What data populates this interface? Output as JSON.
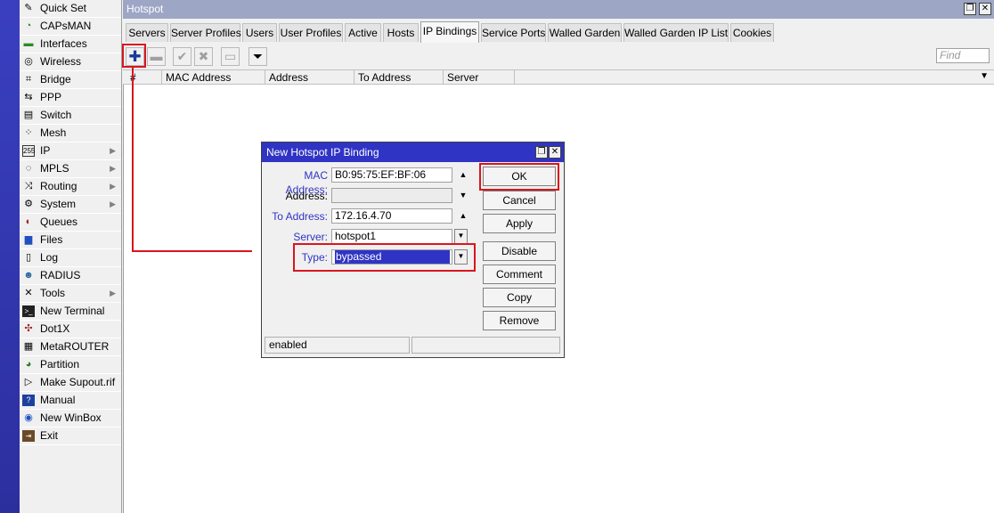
{
  "sidebar": {
    "items": [
      {
        "label": "Quick Set",
        "icon": "wand-icon",
        "submenu": false
      },
      {
        "label": "CAPsMAN",
        "icon": "capsman-icon",
        "submenu": false
      },
      {
        "label": "Interfaces",
        "icon": "interfaces-icon",
        "submenu": false
      },
      {
        "label": "Wireless",
        "icon": "wireless-icon",
        "submenu": false
      },
      {
        "label": "Bridge",
        "icon": "bridge-icon",
        "submenu": false
      },
      {
        "label": "PPP",
        "icon": "ppp-icon",
        "submenu": false
      },
      {
        "label": "Switch",
        "icon": "switch-icon",
        "submenu": false
      },
      {
        "label": "Mesh",
        "icon": "mesh-icon",
        "submenu": false
      },
      {
        "label": "IP",
        "icon": "ip-icon",
        "submenu": true
      },
      {
        "label": "MPLS",
        "icon": "mpls-icon",
        "submenu": true
      },
      {
        "label": "Routing",
        "icon": "routing-icon",
        "submenu": true
      },
      {
        "label": "System",
        "icon": "gear-icon",
        "submenu": true
      },
      {
        "label": "Queues",
        "icon": "queues-icon",
        "submenu": false
      },
      {
        "label": "Files",
        "icon": "folder-icon",
        "submenu": false
      },
      {
        "label": "Log",
        "icon": "log-icon",
        "submenu": false
      },
      {
        "label": "RADIUS",
        "icon": "radius-icon",
        "submenu": false
      },
      {
        "label": "Tools",
        "icon": "tools-icon",
        "submenu": true
      },
      {
        "label": "New Terminal",
        "icon": "terminal-icon",
        "submenu": false
      },
      {
        "label": "Dot1X",
        "icon": "dot1x-icon",
        "submenu": false
      },
      {
        "label": "MetaROUTER",
        "icon": "metarouter-icon",
        "submenu": false
      },
      {
        "label": "Partition",
        "icon": "partition-icon",
        "submenu": false
      },
      {
        "label": "Make Supout.rif",
        "icon": "supout-icon",
        "submenu": false
      },
      {
        "label": "Manual",
        "icon": "manual-icon",
        "submenu": false
      },
      {
        "label": "New WinBox",
        "icon": "winbox-icon",
        "submenu": false
      },
      {
        "label": "Exit",
        "icon": "exit-icon",
        "submenu": false
      }
    ]
  },
  "window": {
    "title": "Hotspot",
    "tabs": [
      {
        "label": "Servers",
        "active": false
      },
      {
        "label": "Server Profiles",
        "active": false
      },
      {
        "label": "Users",
        "active": false
      },
      {
        "label": "User Profiles",
        "active": false
      },
      {
        "label": "Active",
        "active": false
      },
      {
        "label": "Hosts",
        "active": false
      },
      {
        "label": "IP Bindings",
        "active": true
      },
      {
        "label": "Service Ports",
        "active": false
      },
      {
        "label": "Walled Garden",
        "active": false
      },
      {
        "label": "Walled Garden IP List",
        "active": false
      },
      {
        "label": "Cookies",
        "active": false
      }
    ],
    "toolbar": {
      "add_icon": "plus-icon",
      "remove_icon": "minus-icon",
      "enable_icon": "check-icon",
      "disable_icon": "x-icon",
      "comment_icon": "comment-icon",
      "filter_icon": "filter-icon"
    },
    "find_placeholder": "Find",
    "columns": [
      "#",
      "MAC Address",
      "Address",
      "To Address",
      "Server"
    ]
  },
  "dialog": {
    "title": "New Hotspot IP Binding",
    "fields": {
      "mac_address": {
        "label": "MAC Address:",
        "value": "B0:95:75:EF:BF:06"
      },
      "address": {
        "label": "Address:",
        "value": ""
      },
      "to_address": {
        "label": "To Address:",
        "value": "172.16.4.70"
      },
      "server": {
        "label": "Server:",
        "value": "hotspot1"
      },
      "type": {
        "label": "Type:",
        "value": "bypassed"
      }
    },
    "buttons": {
      "ok": "OK",
      "cancel": "Cancel",
      "apply": "Apply",
      "disable": "Disable",
      "comment": "Comment",
      "copy": "Copy",
      "remove": "Remove"
    },
    "status": "enabled"
  },
  "colors": {
    "annotation_red": "#d8161f",
    "dialog_title": "#2f34c4",
    "window_title": "#9ea6c6"
  }
}
